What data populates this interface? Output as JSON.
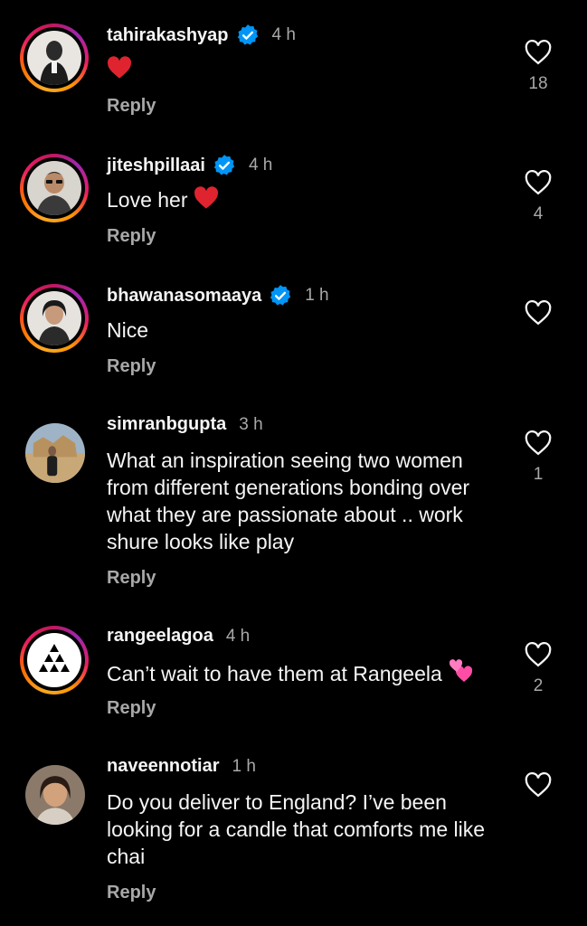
{
  "comments": [
    {
      "username": "tahirakashyap",
      "verified": true,
      "time": "4 h",
      "text": "",
      "emoji": "red-heart",
      "reply_label": "Reply",
      "likes": "18"
    },
    {
      "username": "jiteshpillaai",
      "verified": true,
      "time": "4 h",
      "text": "Love her",
      "emoji": "red-heart",
      "reply_label": "Reply",
      "likes": "4"
    },
    {
      "username": "bhawanasomaaya",
      "verified": true,
      "time": "1 h",
      "text": "Nice",
      "reply_label": "Reply",
      "likes": ""
    },
    {
      "username": "simranbgupta",
      "verified": false,
      "time": "3 h",
      "text": "What an inspiration seeing two women from different generations bonding over what they are passionate about .. work shure looks like play",
      "reply_label": "Reply",
      "likes": "1"
    },
    {
      "username": "rangeelagoa",
      "verified": false,
      "time": "4 h",
      "text": "Can’t wait to have them at Rangeela",
      "emoji": "two-hearts",
      "reply_label": "Reply",
      "likes": "2"
    },
    {
      "username": "naveennotiar",
      "verified": false,
      "time": "1 h",
      "text": "Do you deliver to England? I’ve been looking for a candle that comforts me like chai",
      "reply_label": "Reply",
      "likes": ""
    }
  ],
  "colors": {
    "background": "#000000",
    "primary_text": "#f5f5f5",
    "secondary_text": "#a8a8a8",
    "verified_blue": "#0095f6",
    "heart_red": "#ed4956"
  },
  "icons": {
    "verified": "verified-badge-icon",
    "like": "heart-outline-icon"
  }
}
